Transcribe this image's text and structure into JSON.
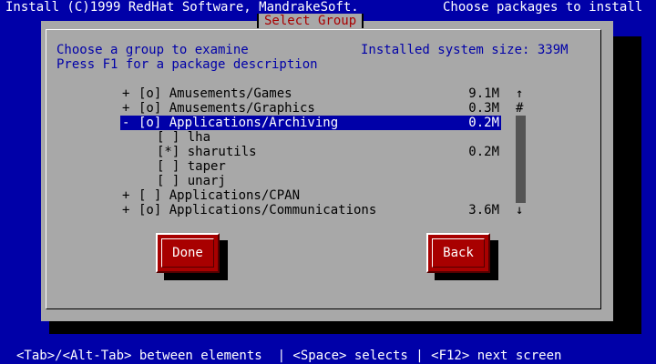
{
  "top_bar": {
    "left": "Install (C)1999 RedHat Software, MandrakeSoft.",
    "right": "Choose packages to install"
  },
  "dialog": {
    "title": "Select Group",
    "line1": "Choose a group to examine",
    "line2": "Press F1 for a package description",
    "size_label": "Installed system size: 339M"
  },
  "list": [
    {
      "mark": "+",
      "name": "[o] Amusements/Games",
      "size": "9.1M",
      "indent": 0,
      "selected": false
    },
    {
      "mark": "+",
      "name": "[o] Amusements/Graphics",
      "size": "0.3M",
      "indent": 0,
      "selected": false
    },
    {
      "mark": "-",
      "name": "[o] Applications/Archiving",
      "size": "0.2M",
      "indent": 0,
      "selected": true
    },
    {
      "mark": "",
      "name": "[ ] lha",
      "size": "",
      "indent": 1,
      "selected": false
    },
    {
      "mark": "",
      "name": "[*] sharutils",
      "size": "0.2M",
      "indent": 1,
      "selected": false
    },
    {
      "mark": "",
      "name": "[ ] taper",
      "size": "",
      "indent": 1,
      "selected": false
    },
    {
      "mark": "",
      "name": "[ ] unarj",
      "size": "",
      "indent": 1,
      "selected": false
    },
    {
      "mark": "+",
      "name": "[ ] Applications/CPAN",
      "size": "",
      "indent": 0,
      "selected": false
    },
    {
      "mark": "+",
      "name": "[o] Applications/Communications",
      "size": "3.6M",
      "indent": 0,
      "selected": false
    }
  ],
  "scrollbar": {
    "up": "↑",
    "thumb": "#",
    "down": "↓"
  },
  "buttons": {
    "done": "Done",
    "back": "Back"
  },
  "colors": {
    "background": "#0000a8",
    "dialog": "#a8a8a8",
    "button": "#a80000",
    "title": "#a80000"
  },
  "status_bar": "<Tab>/<Alt-Tab> between elements  | <Space> selects | <F12> next screen"
}
